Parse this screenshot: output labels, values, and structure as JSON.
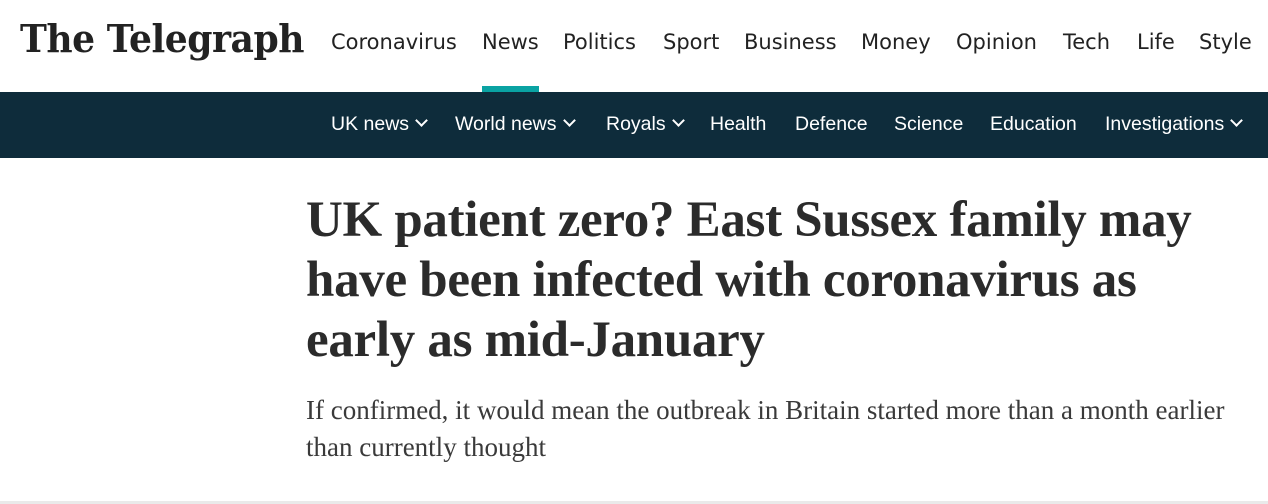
{
  "brand": {
    "logo_text": "The Telegraph"
  },
  "primary_nav": {
    "items": [
      "Coronavirus",
      "News",
      "Politics",
      "Sport",
      "Business",
      "Money",
      "Opinion",
      "Tech",
      "Life",
      "Style"
    ],
    "active": "News",
    "accent_color": "#0aa3a3"
  },
  "section_nav": {
    "background_color": "#0e2c3b",
    "items": [
      {
        "label": "UK news",
        "icon": "chevron-down-icon"
      },
      {
        "label": "World news",
        "icon": "chevron-down-icon"
      },
      {
        "label": "Royals",
        "icon": "chevron-down-icon"
      },
      {
        "label": "Health"
      },
      {
        "label": "Defence"
      },
      {
        "label": "Science"
      },
      {
        "label": "Education"
      },
      {
        "label": "Investigations",
        "icon": "chevron-down-icon"
      }
    ]
  },
  "article": {
    "headline": "UK patient zero? East Sussex family may have been infected with coronavirus as early as mid-January",
    "standfirst": "If confirmed, it would mean the outbreak in Britain started more than a month earlier than currently thought"
  }
}
